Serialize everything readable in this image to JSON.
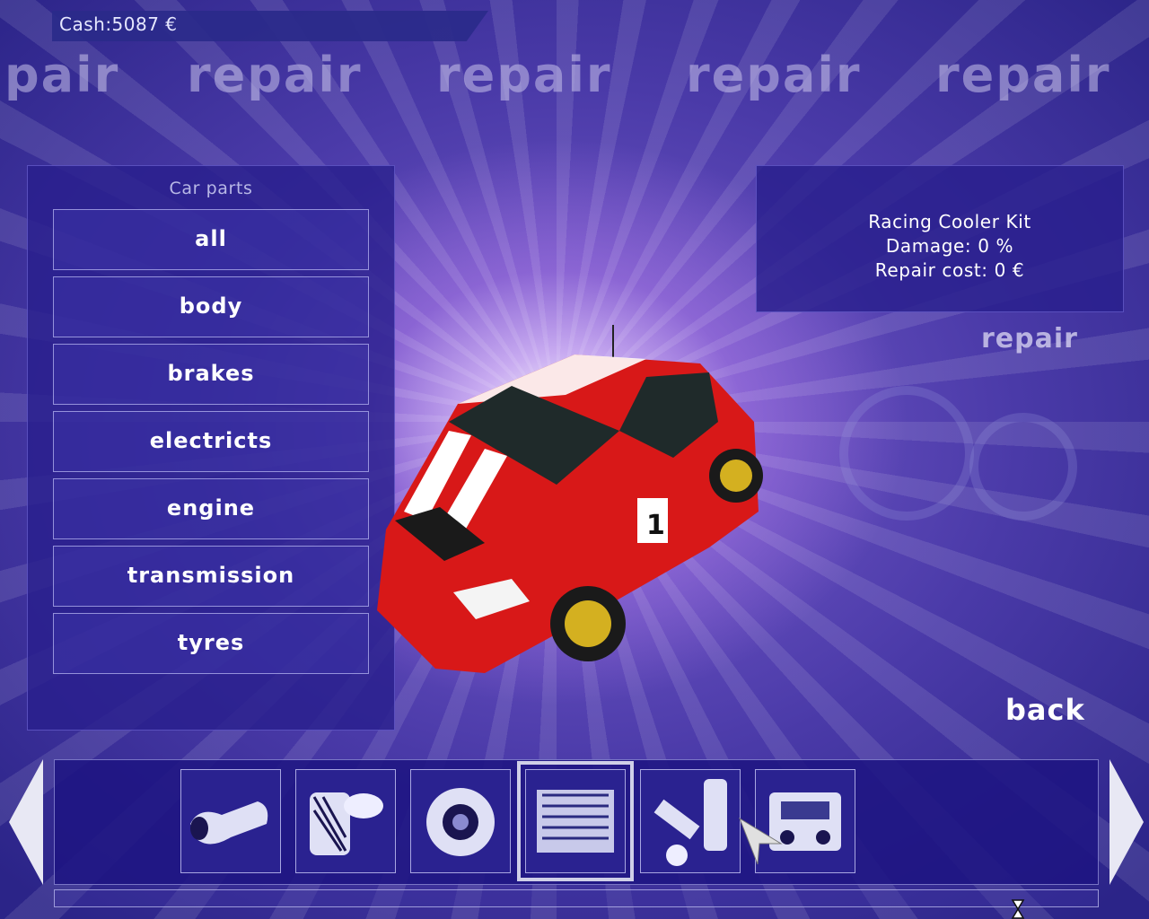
{
  "header": {
    "cash_text": "Cash:5087 €"
  },
  "watermark": {
    "word": "repair",
    "first_fragment": "pair"
  },
  "left_panel": {
    "title": "Car parts",
    "items": [
      {
        "label": "all"
      },
      {
        "label": "body"
      },
      {
        "label": "brakes"
      },
      {
        "label": "electricts"
      },
      {
        "label": "engine"
      },
      {
        "label": "transmission"
      },
      {
        "label": "tyres"
      }
    ]
  },
  "info_panel": {
    "part_name": "Racing Cooler Kit",
    "damage_text": "Damage: 0 %",
    "repair_cost_text": "Repair cost: 0 €"
  },
  "screen_label": "repair",
  "back_label": "back",
  "parts_strip": {
    "selected_index": 3,
    "items": [
      {
        "icon": "exhaust-icon"
      },
      {
        "icon": "air-filter-icon"
      },
      {
        "icon": "turbo-icon"
      },
      {
        "icon": "intercooler-icon"
      },
      {
        "icon": "suspension-icon"
      },
      {
        "icon": "engine-block-icon"
      }
    ]
  },
  "colors": {
    "panel": "#28208c",
    "text": "#ffffff",
    "accent": "#cfcfe8",
    "car_red": "#d81818"
  }
}
